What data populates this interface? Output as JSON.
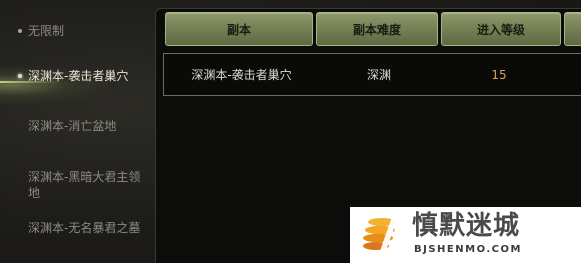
{
  "sidebar": {
    "items": [
      {
        "label": "无限制",
        "active": false
      },
      {
        "label": "深渊本-袭击者巢穴",
        "active": true
      },
      {
        "label": "深渊本-消亡盆地",
        "active": false
      },
      {
        "label": "深渊本-黑暗大君主领地",
        "active": false
      },
      {
        "label": "深渊本-无名暴君之墓",
        "active": false
      }
    ]
  },
  "table": {
    "headers": [
      "副本",
      "副本难度",
      "进入等级",
      ""
    ],
    "rows": [
      {
        "dungeon": "深渊本-袭击者巢穴",
        "difficulty": "深渊",
        "level": "15"
      }
    ]
  },
  "watermark": {
    "title": "慎默迷城",
    "subtitle": "BJSHENMO.COM"
  },
  "colors": {
    "header_bg": "#717d52",
    "level_text": "#d9a15a",
    "panel_bg": "#0c0c0b"
  }
}
